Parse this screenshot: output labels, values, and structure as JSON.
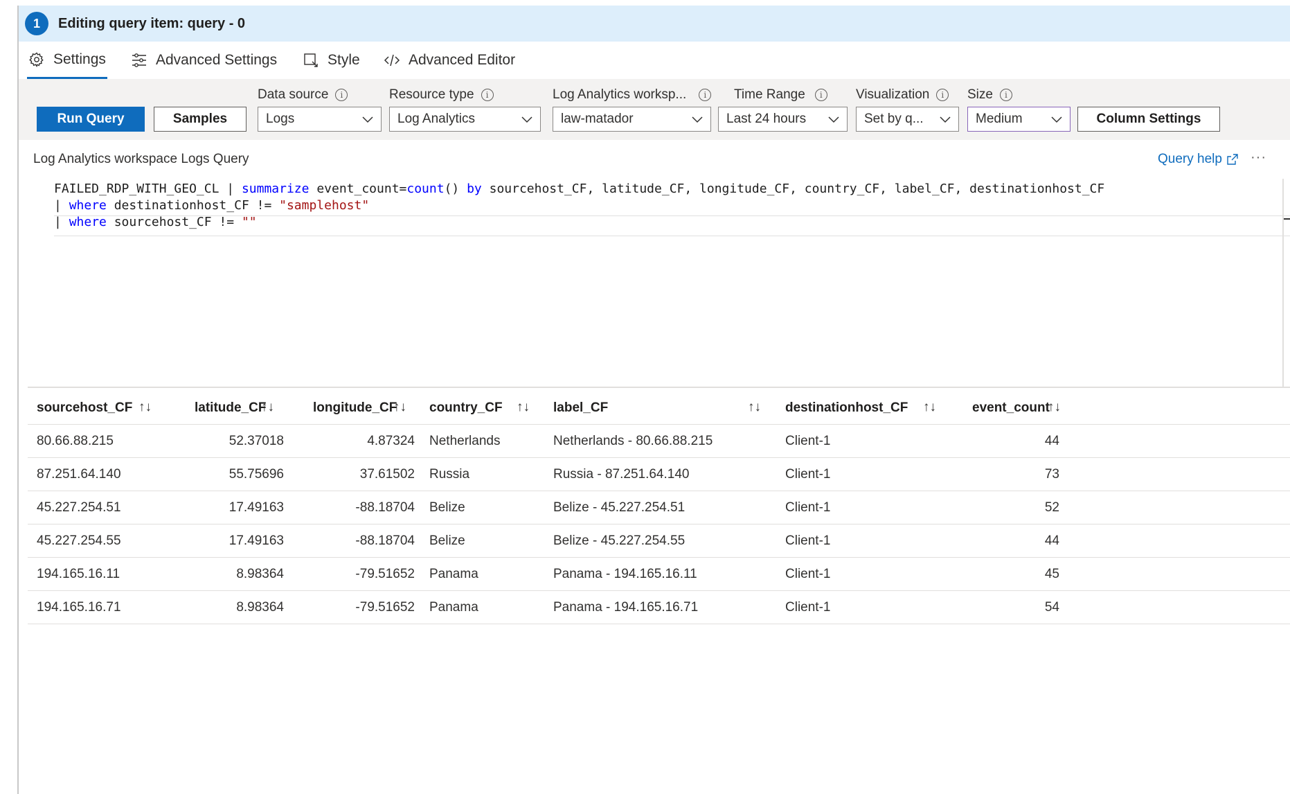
{
  "header": {
    "step": "1",
    "title": "Editing query item: query - 0"
  },
  "tabs": [
    {
      "label": "Settings",
      "icon": "gear-icon"
    },
    {
      "label": "Advanced Settings",
      "icon": "sliders-icon"
    },
    {
      "label": "Style",
      "icon": "style-icon"
    },
    {
      "label": "Advanced Editor",
      "icon": "code-icon"
    }
  ],
  "toolbar": {
    "run_label": "Run Query",
    "samples_label": "Samples",
    "column_settings_label": "Column Settings",
    "data_source": {
      "label": "Data source",
      "value": "Logs"
    },
    "resource_type": {
      "label": "Resource type",
      "value": "Log Analytics"
    },
    "workspace": {
      "label": "Log Analytics worksp...",
      "value": "law-matador"
    },
    "time_range": {
      "label": "Time Range",
      "value": "Last 24 hours"
    },
    "visualization": {
      "label": "Visualization",
      "value": "Set by q..."
    },
    "size": {
      "label": "Size",
      "value": "Medium"
    }
  },
  "query": {
    "label": "Log Analytics workspace Logs Query",
    "help_label": "Query help",
    "more_label": "···",
    "line1_table": "FAILED_RDP_WITH_GEO_CL | ",
    "line1_kw1": "summarize",
    "line1_mid": " event_count=",
    "line1_kw2": "count",
    "line1_paren": "() ",
    "line1_kw3": "by",
    "line1_rest": " sourcehost_CF, latitude_CF, longitude_CF, country_CF, label_CF, destinationhost_CF",
    "line2_pipe": "| ",
    "line2_kw": "where",
    "line2_mid": " destinationhost_CF != ",
    "line2_str": "\"samplehost\"",
    "line3_pipe": "| ",
    "line3_kw": "where",
    "line3_mid": " sourcehost_CF != ",
    "line3_str": "\"\""
  },
  "grid": {
    "columns": [
      "sourcehost_CF",
      "latitude_CF",
      "longitude_CF",
      "country_CF",
      "label_CF",
      "destinationhost_CF",
      "event_count"
    ],
    "sort_glyph": "↑↓",
    "rows": [
      [
        "80.66.88.215",
        "52.37018",
        "4.87324",
        "Netherlands",
        "Netherlands - 80.66.88.215",
        "Client-1",
        "44"
      ],
      [
        "87.251.64.140",
        "55.75696",
        "37.61502",
        "Russia",
        "Russia - 87.251.64.140",
        "Client-1",
        "73"
      ],
      [
        "45.227.254.51",
        "17.49163",
        "-88.18704",
        "Belize",
        "Belize - 45.227.254.51",
        "Client-1",
        "52"
      ],
      [
        "45.227.254.55",
        "17.49163",
        "-88.18704",
        "Belize",
        "Belize - 45.227.254.55",
        "Client-1",
        "44"
      ],
      [
        "194.165.16.11",
        "8.98364",
        "-79.51652",
        "Panama",
        "Panama - 194.165.16.11",
        "Client-1",
        "45"
      ],
      [
        "194.165.16.71",
        "8.98364",
        "-79.51652",
        "Panama",
        "Panama - 194.165.16.71",
        "Client-1",
        "54"
      ]
    ]
  },
  "colors": {
    "accent": "#0f6cbd",
    "header_bg": "#ddeefb",
    "toolbar_bg": "#f3f2f1",
    "size_border": "#8764b8"
  }
}
